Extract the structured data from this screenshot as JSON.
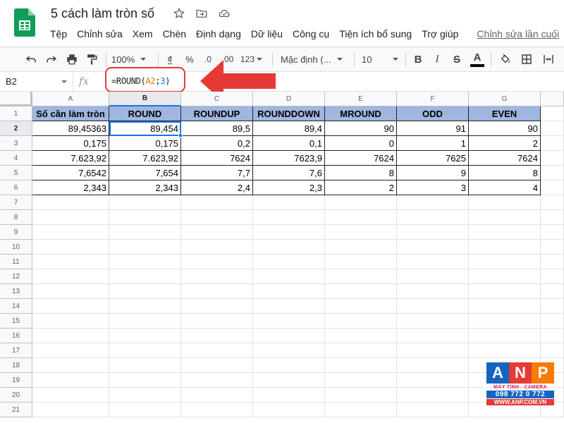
{
  "document": {
    "title": "5 cách làm tròn số"
  },
  "menu": {
    "items": [
      "Tệp",
      "Chỉnh sửa",
      "Xem",
      "Chèn",
      "Định dạng",
      "Dữ liệu",
      "Công cụ",
      "Tiện ích bổ sung",
      "Trợ giúp"
    ],
    "last_edit": "Chỉnh sửa lần cuối"
  },
  "toolbar": {
    "zoom": "100%",
    "currency": "₫",
    "percent": "%",
    "decimal_decrease": ".0",
    "decimal_increase": ".00",
    "more_formats": "123",
    "font": "Mặc định (...",
    "font_size": "10",
    "bold": "B",
    "italic": "I",
    "strikethrough": "S",
    "text_color": "A"
  },
  "formula_bar": {
    "cell_ref": "B2",
    "fx": "fx",
    "formula_prefix": "=ROUND(",
    "formula_ref": "A2",
    "formula_sep": ";",
    "formula_digits": "3",
    "formula_suffix": ")"
  },
  "sheet": {
    "columns": [
      "A",
      "B",
      "C",
      "D",
      "E",
      "F",
      "G"
    ],
    "rows": [
      "1",
      "2",
      "3",
      "4",
      "5",
      "6",
      "7",
      "8",
      "9",
      "10",
      "11",
      "12",
      "13",
      "14",
      "15",
      "16",
      "17",
      "18",
      "19",
      "20",
      "21"
    ],
    "selected_cell": "B2",
    "header_row": [
      "Số cần làm tròn",
      "ROUND",
      "ROUNDUP",
      "ROUNDDOWN",
      "MROUND",
      "ODD",
      "EVEN"
    ],
    "data_rows": [
      [
        "89,45363",
        "89,454",
        "89,5",
        "89,4",
        "90",
        "91",
        "90"
      ],
      [
        "0,175",
        "0,175",
        "0,2",
        "0,1",
        "0",
        "1",
        "2"
      ],
      [
        "7.623,92",
        "7.623,92",
        "7624",
        "7623,9",
        "7624",
        "7625",
        "7624"
      ],
      [
        "7,6542",
        "7,654",
        "7,7",
        "7,6",
        "8",
        "9",
        "8"
      ],
      [
        "2,343",
        "2,343",
        "2,4",
        "2,3",
        "2",
        "3",
        "4"
      ]
    ]
  },
  "watermark": {
    "letters": [
      "A",
      "N",
      "P"
    ],
    "subtitle": "MÁY TÍNH - CAMERA",
    "phone": "098 772 0 772",
    "website": "WWW.ANP.COM.VN"
  },
  "colors": {
    "header_fill": "#9fb6df",
    "selection": "#1a73e8",
    "annotation_red": "#e53935",
    "sheets_green": "#0f9d58"
  }
}
